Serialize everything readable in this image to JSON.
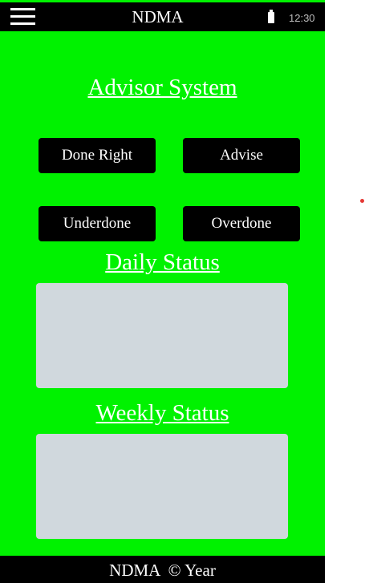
{
  "header": {
    "menu_icon": "hamburger-menu-icon",
    "title": "NDMA",
    "battery_icon": "battery-icon",
    "time": "12:30"
  },
  "main": {
    "title": "Advisor System",
    "buttons": {
      "done_right": "Done Right",
      "advise": "Advise",
      "underdone": "Underdone",
      "overdone": "Overdone"
    },
    "daily_status": {
      "title": "Daily Status"
    },
    "weekly_status": {
      "title": "Weekly Status"
    }
  },
  "footer": {
    "text": "NDMA  © Year"
  },
  "colors": {
    "background": "#00f200",
    "bars": "#000000",
    "panel": "#d0d8dd",
    "text": "#ffffff"
  }
}
